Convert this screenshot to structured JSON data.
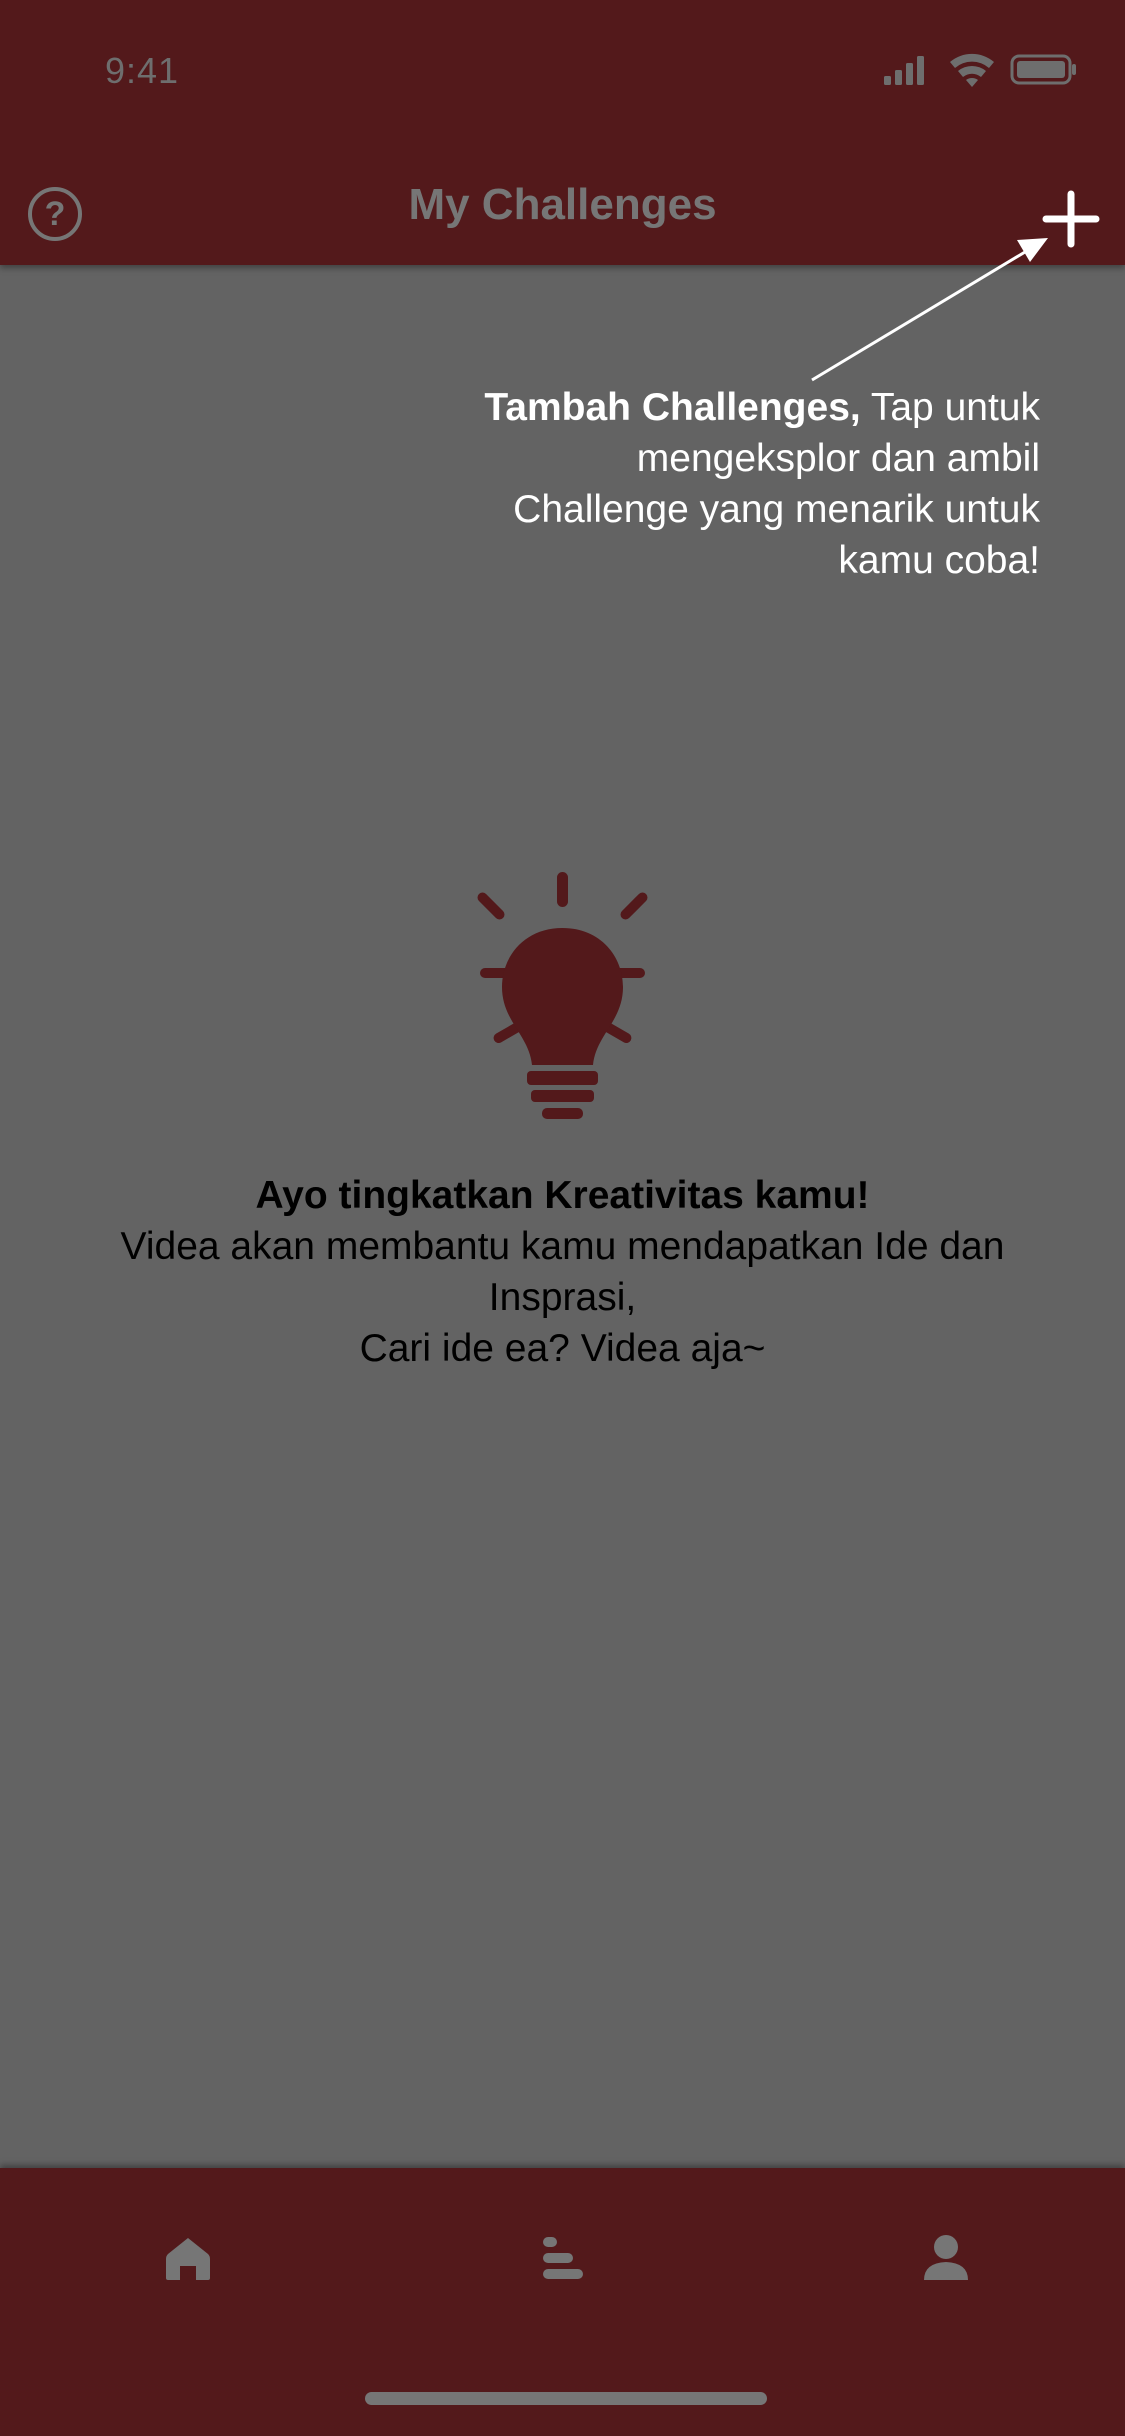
{
  "status_bar": {
    "time": "9:41"
  },
  "header": {
    "title": "My Challenges",
    "help_label": "?"
  },
  "tooltip": {
    "title": "Tambah Challenges,",
    "body": " Tap untuk mengeksplor dan ambil Challenge yang menarik untuk kamu coba!"
  },
  "empty_state": {
    "icon": "lightbulb-icon",
    "title": "Ayo tingkatkan Kreativitas kamu!",
    "line1": "Videa akan membantu kamu mendapatkan Ide dan Insprasi,",
    "line2": "Cari ide ea? Videa aja~"
  },
  "tab_bar": {
    "tabs": [
      "home-icon",
      "leaderboard-icon",
      "profile-icon"
    ]
  },
  "colors": {
    "bar": "#53191b",
    "overlay": "#636363",
    "accent": "#53191b"
  }
}
